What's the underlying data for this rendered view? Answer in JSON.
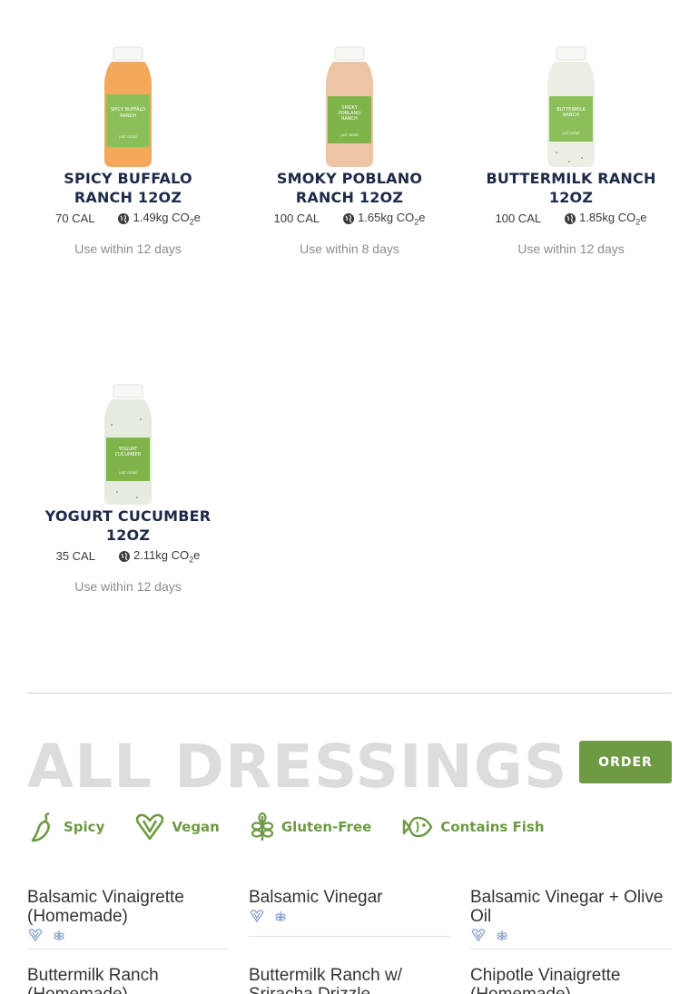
{
  "products": [
    {
      "name": "SPICY BUFFALO RANCH 12OZ",
      "cal": "70 CAL",
      "co2_value": "1.49kg CO",
      "co2_sub": "2",
      "co2_suffix": "e",
      "use": "Use within 12 days",
      "bottle_color": "#f3a85c",
      "label_text": "SPICY BUFFALO RANCH"
    },
    {
      "name": "SMOKY POBLANO RANCH 12OZ",
      "cal": "100 CAL",
      "co2_value": "1.65kg CO",
      "co2_sub": "2",
      "co2_suffix": "e",
      "use": "Use within 8 days",
      "bottle_color": "#ecc6a4",
      "label_text": "SMOKY POBLANO RANCH"
    },
    {
      "name": "BUTTERMILK RANCH 12OZ",
      "cal": "100 CAL",
      "co2_value": "1.85kg CO",
      "co2_sub": "2",
      "co2_suffix": "e",
      "use": "Use within 12 days",
      "bottle_color": "#edefe6",
      "label_text": "BUTTERMILK RANCH"
    },
    {
      "name": "YOGURT CUCUMBER 12OZ",
      "cal": "35 CAL",
      "co2_value": "2.11kg CO",
      "co2_sub": "2",
      "co2_suffix": "e",
      "use": "Use within 12 days",
      "bottle_color": "#e6ebdf",
      "label_text": "YOGURT CUCUMBER"
    }
  ],
  "section": {
    "title": "ALL DRESSINGS",
    "order_label": "ORDER"
  },
  "legend": [
    {
      "label": "Spicy",
      "icon": "pepper-icon"
    },
    {
      "label": "Vegan",
      "icon": "vegan-heart-icon"
    },
    {
      "label": "Gluten-Free",
      "icon": "wheat-icon"
    },
    {
      "label": "Contains Fish",
      "icon": "fish-icon"
    }
  ],
  "dressings": [
    {
      "name": "Balsamic Vinaigrette (Homemade)",
      "vegan": true,
      "gluten_free": true
    },
    {
      "name": "Balsamic Vinegar",
      "vegan": true,
      "gluten_free": true
    },
    {
      "name": "Balsamic Vinegar + Olive Oil",
      "vegan": true,
      "gluten_free": true
    },
    {
      "name": "Buttermilk Ranch (Homemade)"
    },
    {
      "name": "Buttermilk Ranch w/ Sriracha Drizzle"
    },
    {
      "name": "Chipotle Vinaigrette (Homemade)"
    }
  ],
  "colors": {
    "accent": "#6f9a44",
    "title": "#1d2a47",
    "muted": "#8c8c8c"
  }
}
